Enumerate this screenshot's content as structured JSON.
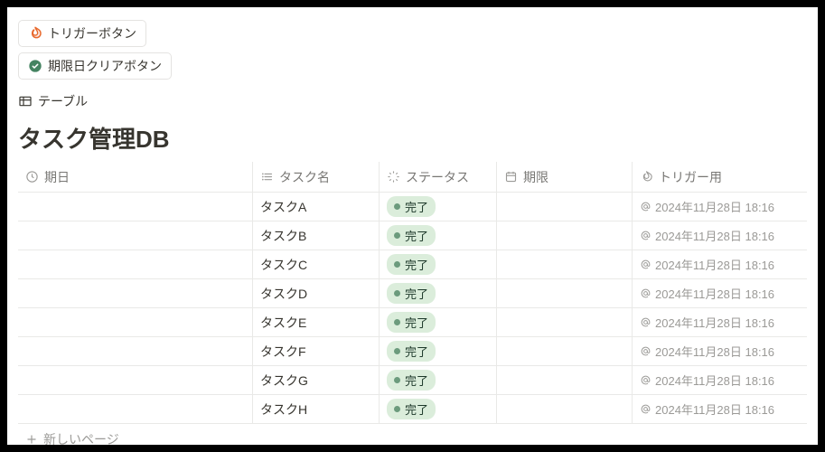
{
  "buttons": {
    "trigger": "トリガーボタン",
    "clear_due": "期限日クリアボタン"
  },
  "view_tab": "テーブル",
  "db_title": "タスク管理DB",
  "columns": {
    "due_date": "期日",
    "task_name": "タスク名",
    "status": "ステータス",
    "deadline": "期限",
    "trigger": "トリガー用"
  },
  "status_label": "完了",
  "rows": [
    {
      "name": "タスクA",
      "trigger_ts": "2024年11月28日 18:16"
    },
    {
      "name": "タスクB",
      "trigger_ts": "2024年11月28日 18:16"
    },
    {
      "name": "タスクC",
      "trigger_ts": "2024年11月28日 18:16"
    },
    {
      "name": "タスクD",
      "trigger_ts": "2024年11月28日 18:16"
    },
    {
      "name": "タスクE",
      "trigger_ts": "2024年11月28日 18:16"
    },
    {
      "name": "タスクF",
      "trigger_ts": "2024年11月28日 18:16"
    },
    {
      "name": "タスクG",
      "trigger_ts": "2024年11月28日 18:16"
    },
    {
      "name": "タスクH",
      "trigger_ts": "2024年11月28日 18:16"
    }
  ],
  "new_page": "新しいページ",
  "colors": {
    "fire_icon": "#e8682c",
    "check_icon": "#448361",
    "status_bg": "#dbeddb"
  }
}
